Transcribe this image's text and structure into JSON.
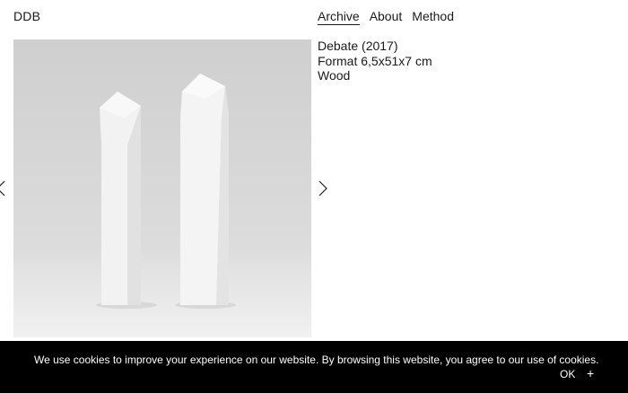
{
  "site": {
    "logo": "DDB"
  },
  "nav": {
    "items": [
      {
        "label": "Archive",
        "active": true
      },
      {
        "label": "About",
        "active": false
      },
      {
        "label": "Method",
        "active": false
      }
    ]
  },
  "artwork": {
    "title": "Debate (2017)",
    "format": "Format 6,5x51x7 cm",
    "material": "Wood"
  },
  "gallery": {
    "prev_icon": "chevron-left-icon",
    "next_icon": "chevron-right-icon"
  },
  "cookie": {
    "message": "We use cookies to improve your experience on our website. By browsing this website, you agree to our use of cookies.",
    "ok_label": "OK",
    "close_label": "+"
  },
  "colors": {
    "text": "#1a1a1a",
    "background": "#ffffff",
    "cookie_bar": "#000000",
    "photo_bg": "#d8d8d8"
  }
}
